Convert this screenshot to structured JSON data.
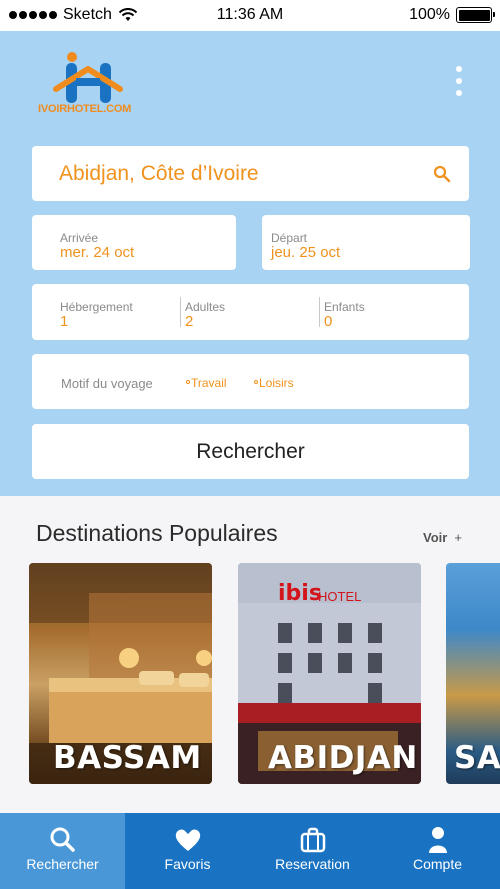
{
  "status_bar": {
    "carrier": "Sketch",
    "time": "11:36 AM",
    "battery": "100%"
  },
  "brand": {
    "logo_text": "IVOIRHOTEL.COM",
    "colors": {
      "primary_blue": "#1973c2",
      "accent_orange": "#f0921e",
      "header_bg": "#a8d3f2"
    }
  },
  "search": {
    "destination": "Abidjan, Côte d’Ivoire",
    "arrival": {
      "label": "Arrivée",
      "value": "mer. 24 oct"
    },
    "departure": {
      "label": "Départ",
      "value": "jeu. 25 oct"
    },
    "lodging": {
      "label": "Hébergement",
      "value": "1"
    },
    "adults": {
      "label": "Adultes",
      "value": "2"
    },
    "children": {
      "label": "Enfants",
      "value": "0"
    },
    "trip_reason": {
      "label": "Motif du voyage",
      "options": [
        "Travail",
        "Loisirs"
      ]
    },
    "button": "Rechercher"
  },
  "popular": {
    "title": "Destinations Populaires",
    "see_more": "Voir",
    "see_more_icon": "+",
    "destinations": [
      {
        "name": "BASSAM"
      },
      {
        "name": "ABIDJAN",
        "hotel_sign": "ibis",
        "hotel_sign_suffix": "HOTEL"
      },
      {
        "name": "SAN"
      }
    ]
  },
  "tabs": [
    {
      "label": "Rechercher",
      "icon": "search-icon",
      "active": true
    },
    {
      "label": "Favoris",
      "icon": "heart-icon",
      "active": false
    },
    {
      "label": "Reservation",
      "icon": "briefcase-icon",
      "active": false
    },
    {
      "label": "Compte",
      "icon": "user-icon",
      "active": false
    }
  ]
}
